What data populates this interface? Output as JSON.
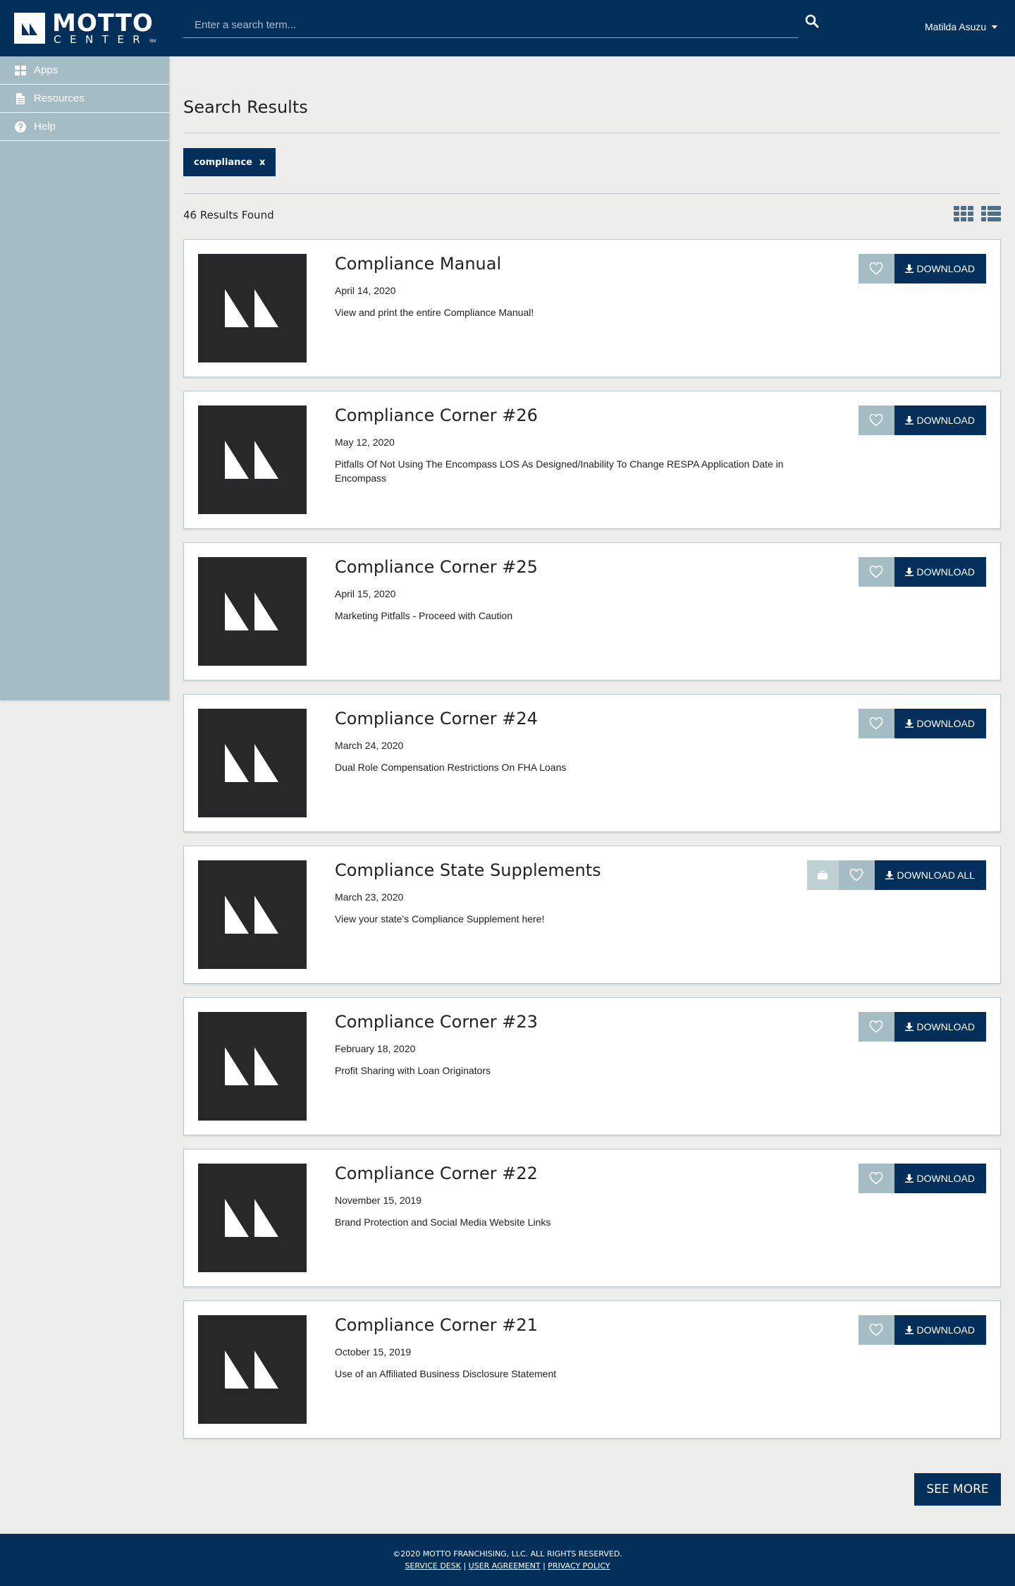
{
  "header": {
    "logo_text": "MOTTO",
    "logo_subtext": "CENTER",
    "logo_sm": "SM",
    "search_placeholder": "Enter a search term...",
    "user_name": "Matilda Asuzu"
  },
  "sidebar": {
    "items": [
      {
        "label": "Apps",
        "icon": "grid-icon"
      },
      {
        "label": "Resources",
        "icon": "document-icon"
      },
      {
        "label": "Help",
        "icon": "question-icon"
      }
    ]
  },
  "main": {
    "title": "Search Results",
    "filter_tag": "compliance",
    "filter_remove": "x",
    "results_count": "46 Results Found",
    "see_more": "SEE MORE"
  },
  "results": [
    {
      "title": "Compliance Manual",
      "date": "April 14, 2020",
      "description": "View and print the entire Compliance Manual!",
      "button": "DOWNLOAD"
    },
    {
      "title": "Compliance Corner #26",
      "date": "May 12, 2020",
      "description": "Pitfalls Of Not Using The Encompass LOS As Designed/Inability To Change RESPA Application Date in Encompass",
      "button": "DOWNLOAD"
    },
    {
      "title": "Compliance Corner #25",
      "date": "April 15, 2020",
      "description": "Marketing Pitfalls - Proceed with Caution",
      "button": "DOWNLOAD"
    },
    {
      "title": "Compliance Corner #24",
      "date": "March 24, 2020",
      "description": "Dual Role Compensation Restrictions On FHA Loans",
      "button": "DOWNLOAD"
    },
    {
      "title": "Compliance State Supplements",
      "date": "March 23, 2020",
      "description": "View your state's Compliance Supplement here!",
      "button": "DOWNLOAD ALL"
    },
    {
      "title": "Compliance Corner #23",
      "date": "February 18, 2020",
      "description": "Profit Sharing with Loan Originators",
      "button": "DOWNLOAD"
    },
    {
      "title": "Compliance Corner #22",
      "date": "November 15, 2019",
      "description": "Brand Protection and Social Media Website Links",
      "button": "DOWNLOAD"
    },
    {
      "title": "Compliance Corner #21",
      "date": "October 15, 2019",
      "description": "Use of an Affiliated Business Disclosure Statement",
      "button": "DOWNLOAD"
    }
  ],
  "footer": {
    "copyright": "©2020 MOTTO FRANCHISING, LLC. ALL RIGHTS RESERVED.",
    "links": [
      "SERVICE DESK",
      "USER AGREEMENT",
      "PRIVACY POLICY"
    ],
    "separator": " | "
  },
  "colors": {
    "brand_navy": "#03305a",
    "sidebar_blue": "#a4bcc3",
    "thumb_dark": "#28272a",
    "page_bg": "#ededec"
  }
}
